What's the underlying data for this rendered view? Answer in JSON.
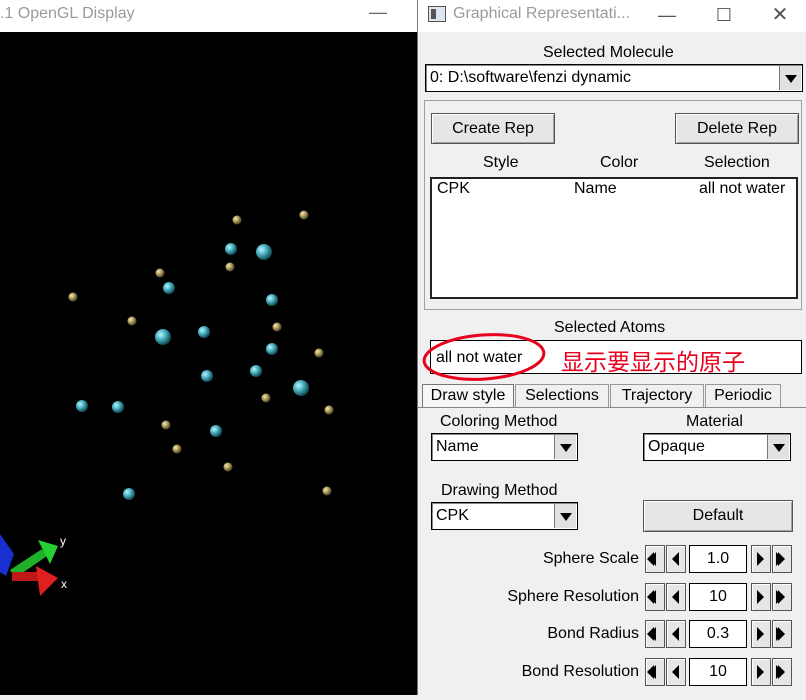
{
  "gl_window": {
    "title": ".1 OpenGL Display",
    "minimize_glyph": "—",
    "axes": {
      "y_label": "y",
      "x_label": "x"
    },
    "atoms": [
      {
        "color": "#4fb8c8",
        "r": 6
      },
      {
        "color": "#c8b670",
        "r": 4.5
      }
    ]
  },
  "graphical_reps": {
    "title": "Graphical Representati...",
    "window_controls": {
      "minimize": "—",
      "maximize": "☐",
      "close": "✕"
    },
    "selected_molecule_label": "Selected Molecule",
    "selected_molecule_value": "0: D:\\software\\fenzi dynamic",
    "create_rep_label": "Create Rep",
    "delete_rep_label": "Delete Rep",
    "columns": {
      "style": "Style",
      "color": "Color",
      "selection": "Selection"
    },
    "reps": [
      {
        "style": "CPK",
        "color": "Name",
        "selection": "all not water"
      }
    ],
    "selected_atoms_label": "Selected Atoms",
    "selected_atoms_value": "all not water",
    "annotation_text": "显示要显示的原子",
    "annotation_color": "#e8001c",
    "tabs": [
      "Draw style",
      "Selections",
      "Trajectory",
      "Periodic"
    ],
    "active_tab": "Draw style",
    "coloring_method_label": "Coloring Method",
    "coloring_method_value": "Name",
    "material_label": "Material",
    "material_value": "Opaque",
    "drawing_method_label": "Drawing Method",
    "drawing_method_value": "CPK",
    "default_button_label": "Default",
    "params": [
      {
        "label": "Sphere Scale",
        "value": "1.0"
      },
      {
        "label": "Sphere Resolution",
        "value": "10"
      },
      {
        "label": "Bond Radius",
        "value": "0.3"
      },
      {
        "label": "Bond Resolution",
        "value": "10"
      }
    ]
  }
}
